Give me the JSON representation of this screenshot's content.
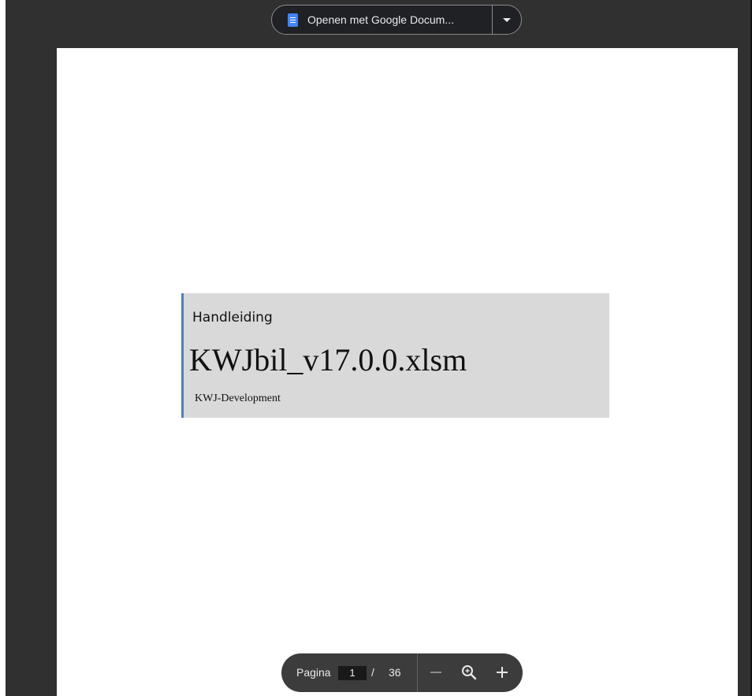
{
  "viewer": {
    "open_with_label": "Openen met Google Docum...",
    "open_with_icon": "google-docs-icon",
    "dropdown_icon": "caret-down-icon"
  },
  "document": {
    "subtitle": "Handleiding",
    "title": "KWJbil_v17.0.0.xlsm",
    "author": "KWJ-Development",
    "accent_color": "#4f81bd",
    "box_color": "#d9d9d9"
  },
  "toolbar": {
    "page_label": "Pagina",
    "current_page": "1",
    "separator": "/",
    "total_pages": "36",
    "zoom_out_icon": "minus-icon",
    "zoom_fit_icon": "zoom-magnifier-icon",
    "zoom_in_icon": "plus-icon"
  }
}
